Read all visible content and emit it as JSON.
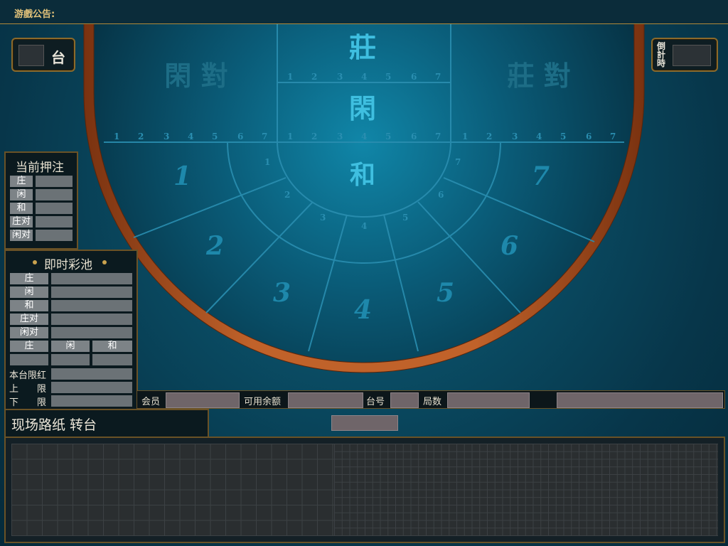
{
  "notice": {
    "label": "游戲公告:"
  },
  "table_number": {
    "label": "台"
  },
  "countdown": {
    "label": "倒計時"
  },
  "felt": {
    "banker_big": "莊",
    "player_mid": "閑",
    "tie": "和",
    "player_pair": "閑 對",
    "banker_pair": "莊 對",
    "scale": [
      "1",
      "2",
      "3",
      "4",
      "5",
      "6",
      "7"
    ],
    "seats": [
      "1",
      "2",
      "3",
      "4",
      "5",
      "6",
      "7"
    ]
  },
  "current_bet": {
    "title": "当前押注",
    "rows": [
      "庄",
      "闲",
      "和",
      "庄对",
      "闲对"
    ]
  },
  "jackpot": {
    "title": "即时彩池",
    "rows": [
      "庄",
      "闲",
      "和",
      "庄对",
      "闲对"
    ],
    "sub_headers": [
      "庄",
      "闲",
      "和"
    ],
    "table_limit": "本台限红",
    "upper": "上　　限",
    "lower": "下　　限"
  },
  "info_bar": {
    "member": "会员",
    "balance": "可用余额",
    "table_no": "台号",
    "rounds": "局数"
  },
  "roadmap": {
    "label": "现场路纸  转台"
  },
  "colors": {
    "felt": "#0a4e66",
    "rim": "#a0501e",
    "gold": "#b08a3a",
    "text_on_felt": "#36b6d8"
  }
}
